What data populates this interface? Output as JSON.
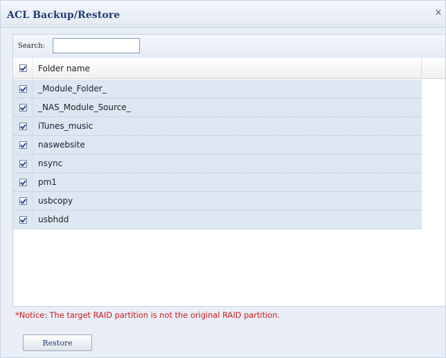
{
  "dialog": {
    "title": "ACL Backup/Restore",
    "close_glyph": "×",
    "close_icon": "close-icon"
  },
  "search": {
    "label": "Search:",
    "value": "",
    "placeholder": ""
  },
  "grid": {
    "header": {
      "label": "Folder name",
      "checked": true
    },
    "rows": [
      {
        "label": "_Module_Folder_",
        "checked": true
      },
      {
        "label": "_NAS_Module_Source_",
        "checked": true
      },
      {
        "label": "iTunes_music",
        "checked": true
      },
      {
        "label": "naswebsite",
        "checked": true
      },
      {
        "label": "nsync",
        "checked": true
      },
      {
        "label": "pm1",
        "checked": true
      },
      {
        "label": "usbcopy",
        "checked": true
      },
      {
        "label": "usbhdd",
        "checked": true
      }
    ]
  },
  "notice": "*Notice: The target RAID partition is not the original RAID partition.",
  "actions": {
    "restore_label": "Restore"
  },
  "colors": {
    "notice": "#d11a1a",
    "row_selected": "#dde6f3",
    "title": "#1f3b71"
  }
}
